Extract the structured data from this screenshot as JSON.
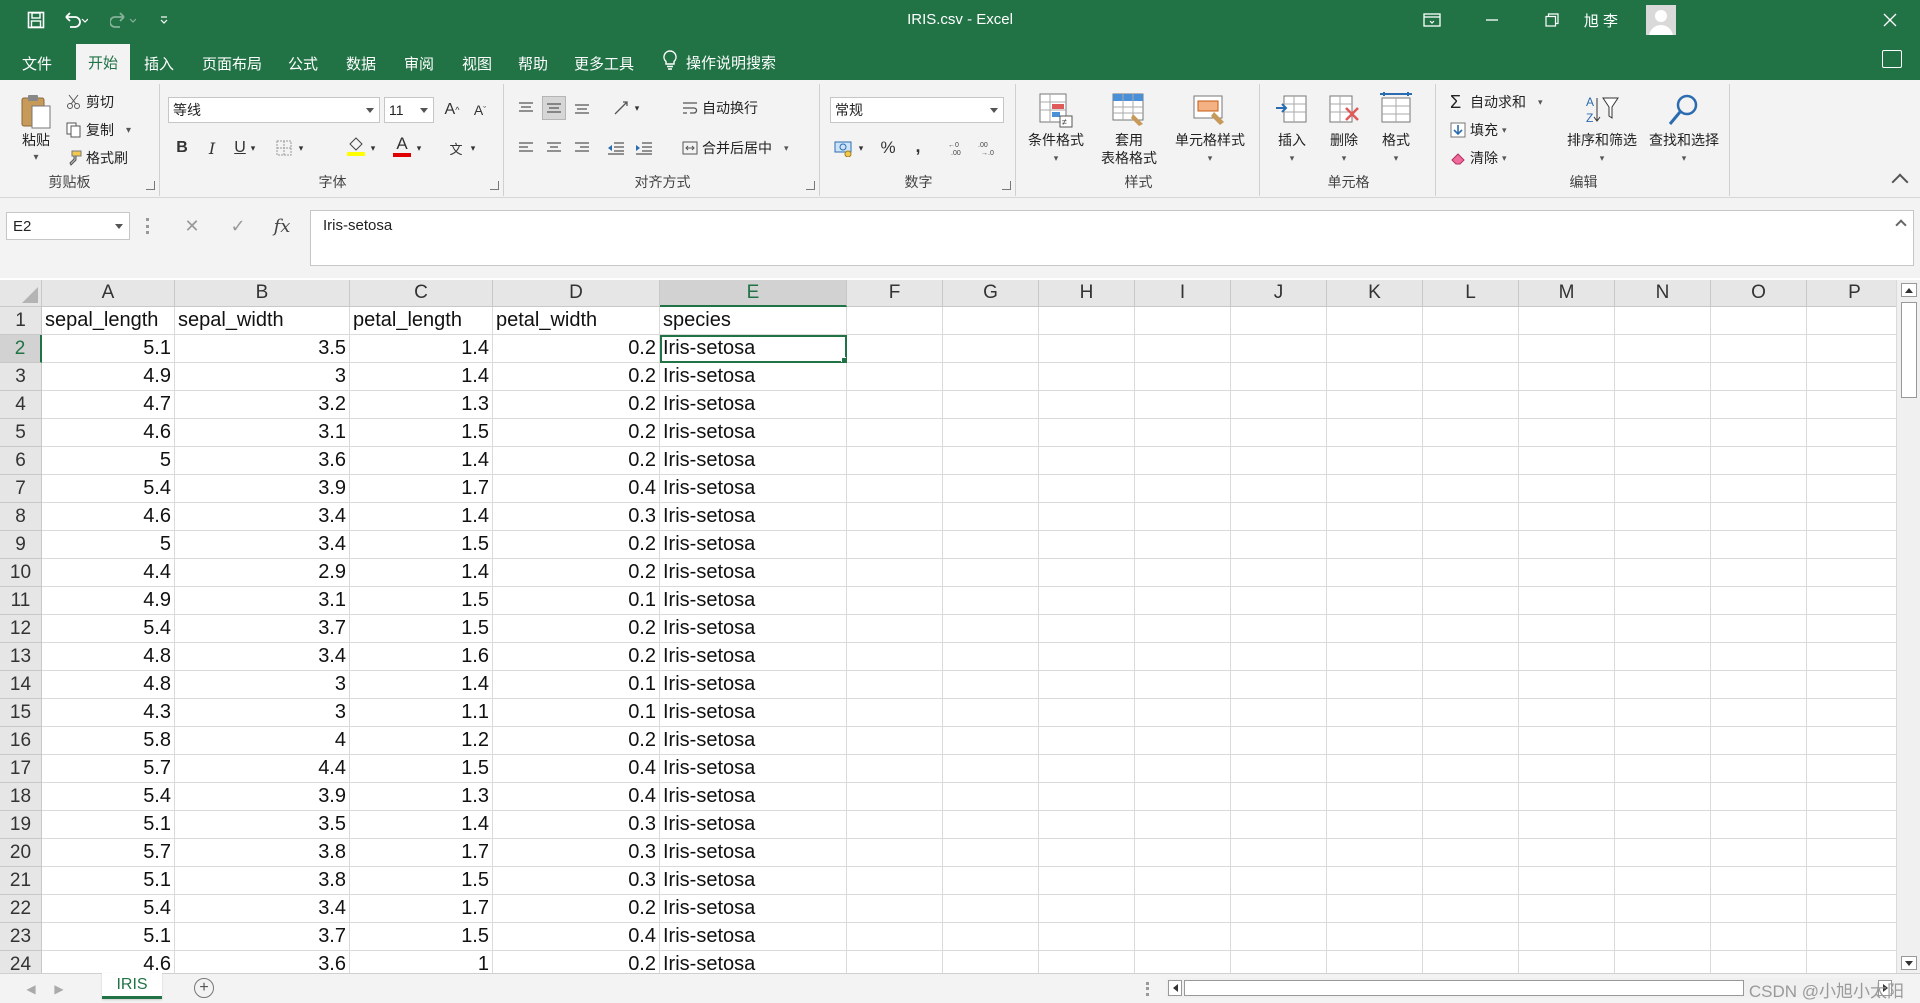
{
  "window": {
    "title": "IRIS.csv  -  Excel",
    "user_name": "旭 李"
  },
  "menu": {
    "tabs": [
      "文件",
      "开始",
      "插入",
      "页面布局",
      "公式",
      "数据",
      "审阅",
      "视图",
      "帮助",
      "更多工具"
    ],
    "active_tab": "开始",
    "tell_me": "操作说明搜索"
  },
  "ribbon": {
    "clipboard": {
      "label": "剪贴板",
      "paste": "粘贴",
      "cut": "剪切",
      "copy": "复制",
      "format_painter": "格式刷"
    },
    "font": {
      "label": "字体",
      "font_name": "等线",
      "font_size": "11",
      "bold": "B",
      "italic": "I",
      "underline": "U",
      "font_color_glyph": "A",
      "phonetic_glyph": "文"
    },
    "alignment": {
      "label": "对齐方式",
      "wrap_text": "自动换行",
      "merge_center": "合并后居中"
    },
    "number": {
      "label": "数字",
      "format": "常规",
      "percent": "%",
      "comma": ","
    },
    "styles": {
      "label": "样式",
      "conditional_format": "条件格式",
      "table_format_line1": "套用",
      "table_format_line2": "表格格式",
      "cell_styles": "单元格样式"
    },
    "cells": {
      "label": "单元格",
      "insert": "插入",
      "delete": "删除",
      "format": "格式"
    },
    "editing": {
      "label": "编辑",
      "autosum": "自动求和",
      "fill": "填充",
      "clear": "清除",
      "sort_filter": "排序和筛选",
      "find_select": "查找和选择"
    }
  },
  "formula_bar": {
    "name_box": "E2",
    "fx": "fx",
    "content": "Iris-setosa"
  },
  "sheet": {
    "columns": [
      "A",
      "B",
      "C",
      "D",
      "E",
      "F",
      "G",
      "H",
      "I",
      "J",
      "K",
      "L",
      "M",
      "N",
      "O",
      "P"
    ],
    "selected_column": "E",
    "selected_row": "2",
    "header_row": [
      "sepal_length",
      "sepal_width",
      "petal_length",
      "petal_width",
      "species"
    ],
    "data_rows": [
      [
        "5.1",
        "3.5",
        "1.4",
        "0.2",
        "Iris-setosa"
      ],
      [
        "4.9",
        "3",
        "1.4",
        "0.2",
        "Iris-setosa"
      ],
      [
        "4.7",
        "3.2",
        "1.3",
        "0.2",
        "Iris-setosa"
      ],
      [
        "4.6",
        "3.1",
        "1.5",
        "0.2",
        "Iris-setosa"
      ],
      [
        "5",
        "3.6",
        "1.4",
        "0.2",
        "Iris-setosa"
      ],
      [
        "5.4",
        "3.9",
        "1.7",
        "0.4",
        "Iris-setosa"
      ],
      [
        "4.6",
        "3.4",
        "1.4",
        "0.3",
        "Iris-setosa"
      ],
      [
        "5",
        "3.4",
        "1.5",
        "0.2",
        "Iris-setosa"
      ],
      [
        "4.4",
        "2.9",
        "1.4",
        "0.2",
        "Iris-setosa"
      ],
      [
        "4.9",
        "3.1",
        "1.5",
        "0.1",
        "Iris-setosa"
      ],
      [
        "5.4",
        "3.7",
        "1.5",
        "0.2",
        "Iris-setosa"
      ],
      [
        "4.8",
        "3.4",
        "1.6",
        "0.2",
        "Iris-setosa"
      ],
      [
        "4.8",
        "3",
        "1.4",
        "0.1",
        "Iris-setosa"
      ],
      [
        "4.3",
        "3",
        "1.1",
        "0.1",
        "Iris-setosa"
      ],
      [
        "5.8",
        "4",
        "1.2",
        "0.2",
        "Iris-setosa"
      ],
      [
        "5.7",
        "4.4",
        "1.5",
        "0.4",
        "Iris-setosa"
      ],
      [
        "5.4",
        "3.9",
        "1.3",
        "0.4",
        "Iris-setosa"
      ],
      [
        "5.1",
        "3.5",
        "1.4",
        "0.3",
        "Iris-setosa"
      ],
      [
        "5.7",
        "3.8",
        "1.7",
        "0.3",
        "Iris-setosa"
      ],
      [
        "5.1",
        "3.8",
        "1.5",
        "0.3",
        "Iris-setosa"
      ],
      [
        "5.4",
        "3.4",
        "1.7",
        "0.2",
        "Iris-setosa"
      ],
      [
        "5.1",
        "3.7",
        "1.5",
        "0.4",
        "Iris-setosa"
      ],
      [
        "4.6",
        "3.6",
        "1",
        "0.2",
        "Iris-setosa"
      ]
    ],
    "tab_name": "IRIS"
  },
  "watermark": "CSDN @小旭小太阳",
  "colors": {
    "excel_green": "#217346",
    "ribbon_bg": "#f3f3f3",
    "header_bg": "#e6e6e6",
    "gridline": "#dadada"
  }
}
